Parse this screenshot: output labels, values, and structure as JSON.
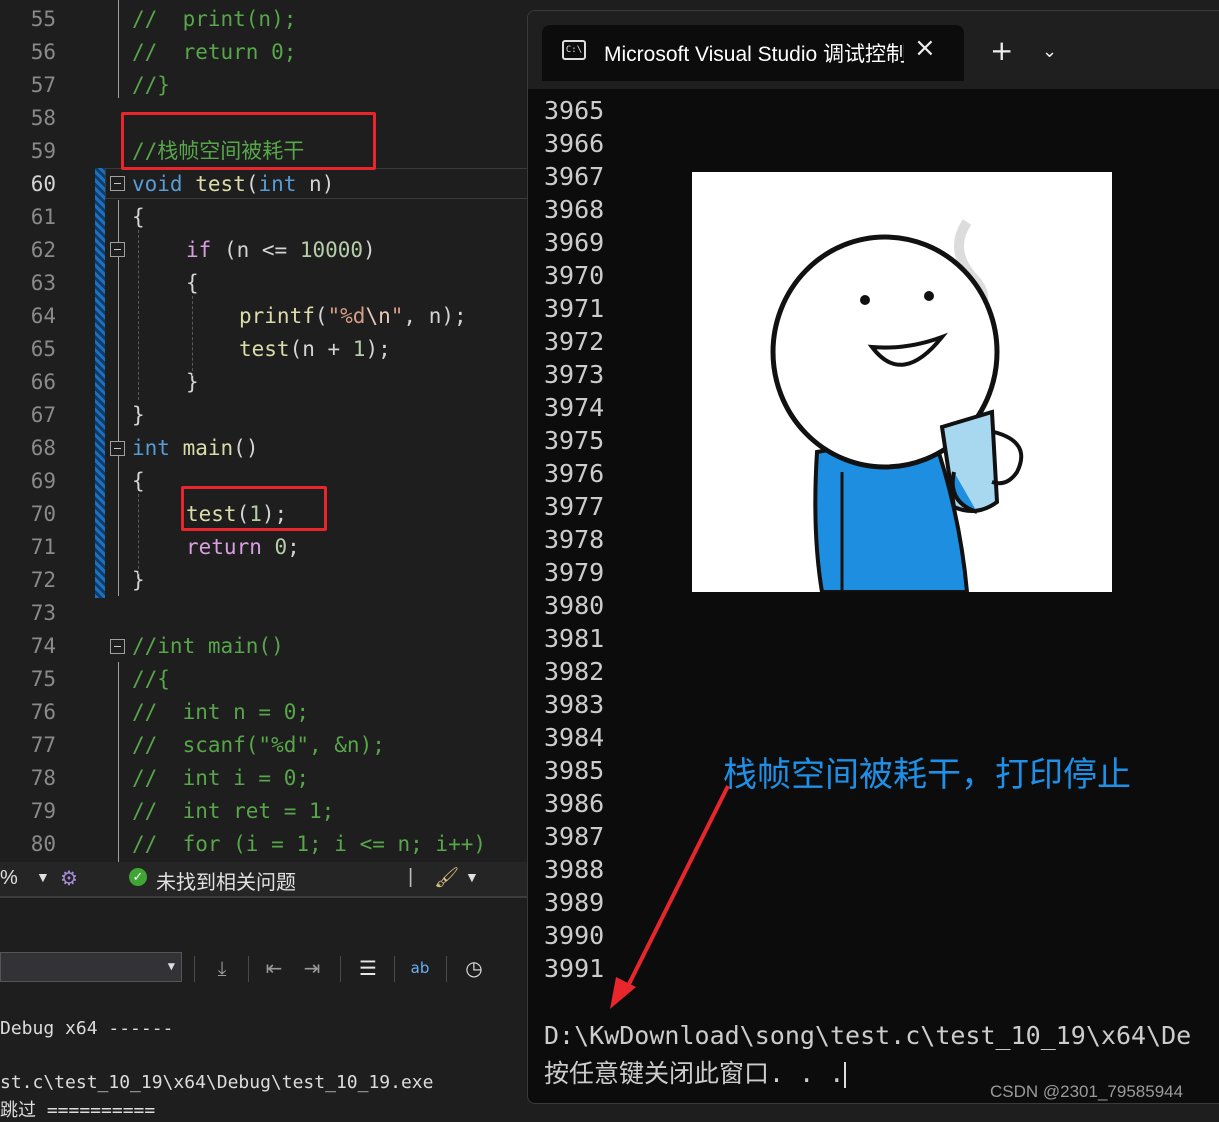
{
  "editor": {
    "lines": [
      {
        "num": "55",
        "code": [
          {
            "t": "//  print(n);",
            "c": "cmt"
          }
        ],
        "indent": 132
      },
      {
        "num": "56",
        "code": [
          {
            "t": "//  return 0;",
            "c": "cmt"
          }
        ],
        "indent": 132
      },
      {
        "num": "57",
        "code": [
          {
            "t": "//}",
            "c": "cmt"
          }
        ],
        "indent": 132
      },
      {
        "num": "58",
        "code": [],
        "indent": 132
      },
      {
        "num": "59",
        "code": [
          {
            "t": "//栈帧空间被耗干",
            "c": "cmt"
          }
        ],
        "indent": 132
      },
      {
        "num": "60",
        "code": [
          {
            "t": "void",
            "c": "kw"
          },
          {
            "t": " ",
            "c": "pl"
          },
          {
            "t": "test",
            "c": "fn"
          },
          {
            "t": "(",
            "c": "pl"
          },
          {
            "t": "int",
            "c": "kw"
          },
          {
            "t": " n)",
            "c": "pl"
          }
        ],
        "indent": 132,
        "current": true
      },
      {
        "num": "61",
        "code": [
          {
            "t": "{",
            "c": "pl"
          }
        ],
        "indent": 132
      },
      {
        "num": "62",
        "code": [
          {
            "t": "if",
            "c": "ctl"
          },
          {
            "t": " (n <= ",
            "c": "pl"
          },
          {
            "t": "10000",
            "c": "num"
          },
          {
            "t": ")",
            "c": "pl"
          }
        ],
        "indent": 186
      },
      {
        "num": "63",
        "code": [
          {
            "t": "{",
            "c": "pl"
          }
        ],
        "indent": 186
      },
      {
        "num": "64",
        "code": [
          {
            "t": "printf",
            "c": "fn"
          },
          {
            "t": "(",
            "c": "pl"
          },
          {
            "t": "\"%d",
            "c": "str"
          },
          {
            "t": "\\n",
            "c": "esc"
          },
          {
            "t": "\"",
            "c": "str"
          },
          {
            "t": ", n);",
            "c": "pl"
          }
        ],
        "indent": 239
      },
      {
        "num": "65",
        "code": [
          {
            "t": "test",
            "c": "fn"
          },
          {
            "t": "(n + ",
            "c": "pl"
          },
          {
            "t": "1",
            "c": "num"
          },
          {
            "t": ");",
            "c": "pl"
          }
        ],
        "indent": 239
      },
      {
        "num": "66",
        "code": [
          {
            "t": "}",
            "c": "pl"
          }
        ],
        "indent": 186
      },
      {
        "num": "67",
        "code": [
          {
            "t": "}",
            "c": "pl"
          }
        ],
        "indent": 132
      },
      {
        "num": "68",
        "code": [
          {
            "t": "int",
            "c": "kw"
          },
          {
            "t": " ",
            "c": "pl"
          },
          {
            "t": "main",
            "c": "fn"
          },
          {
            "t": "()",
            "c": "pl"
          }
        ],
        "indent": 132
      },
      {
        "num": "69",
        "code": [
          {
            "t": "{",
            "c": "pl"
          }
        ],
        "indent": 132
      },
      {
        "num": "70",
        "code": [
          {
            "t": "test",
            "c": "fn"
          },
          {
            "t": "(",
            "c": "pl"
          },
          {
            "t": "1",
            "c": "num"
          },
          {
            "t": ");",
            "c": "pl"
          }
        ],
        "indent": 186
      },
      {
        "num": "71",
        "code": [
          {
            "t": "return",
            "c": "ctl"
          },
          {
            "t": " ",
            "c": "pl"
          },
          {
            "t": "0",
            "c": "num"
          },
          {
            "t": ";",
            "c": "pl"
          }
        ],
        "indent": 186
      },
      {
        "num": "72",
        "code": [
          {
            "t": "}",
            "c": "pl"
          }
        ],
        "indent": 132
      },
      {
        "num": "73",
        "code": [],
        "indent": 132
      },
      {
        "num": "74",
        "code": [
          {
            "t": "//int main()",
            "c": "cmt"
          }
        ],
        "indent": 132
      },
      {
        "num": "75",
        "code": [
          {
            "t": "//{",
            "c": "cmt"
          }
        ],
        "indent": 132
      },
      {
        "num": "76",
        "code": [
          {
            "t": "//  int n = 0;",
            "c": "cmt"
          }
        ],
        "indent": 132
      },
      {
        "num": "77",
        "code": [
          {
            "t": "//  scanf(\"%d\", &n);",
            "c": "cmt"
          }
        ],
        "indent": 132
      },
      {
        "num": "78",
        "code": [
          {
            "t": "//  int i = 0;",
            "c": "cmt"
          }
        ],
        "indent": 132
      },
      {
        "num": "79",
        "code": [
          {
            "t": "//  int ret = 1;",
            "c": "cmt"
          }
        ],
        "indent": 132
      },
      {
        "num": "80",
        "code": [
          {
            "t": "//  for (i = 1; i <= n; i++)",
            "c": "cmt"
          }
        ],
        "indent": 132
      }
    ]
  },
  "statusbar": {
    "zoom": "%",
    "issues_text": "未找到相关问题"
  },
  "output": {
    "line1": "Debug x64 ------",
    "line2": "st.c\\test_10_19\\x64\\Debug\\test_10_19.exe",
    "line3": "跳过 =========="
  },
  "console": {
    "tab_title": "Microsoft Visual Studio 调试控制台",
    "numbers": [
      "3965",
      "3966",
      "3967",
      "3968",
      "3969",
      "3970",
      "3971",
      "3972",
      "3973",
      "3974",
      "3975",
      "3976",
      "3977",
      "3978",
      "3979",
      "3980",
      "3981",
      "3982",
      "3983",
      "3984",
      "3985",
      "3986",
      "3987",
      "3988",
      "3989",
      "3990",
      "3991"
    ],
    "path_line": "D:\\KwDownload\\song\\test.c\\test_10_19\\x64\\De",
    "prompt_line": "按任意键关闭此窗口. . ."
  },
  "annotation": "栈帧空间被耗干，打印停止",
  "watermark": "CSDN @2301_79585944",
  "colors": {
    "accent_red": "#e8262c",
    "annotation_blue": "#1e90e8",
    "comment": "#57a64a",
    "keyword": "#569cd6",
    "function": "#dcdcaa"
  }
}
